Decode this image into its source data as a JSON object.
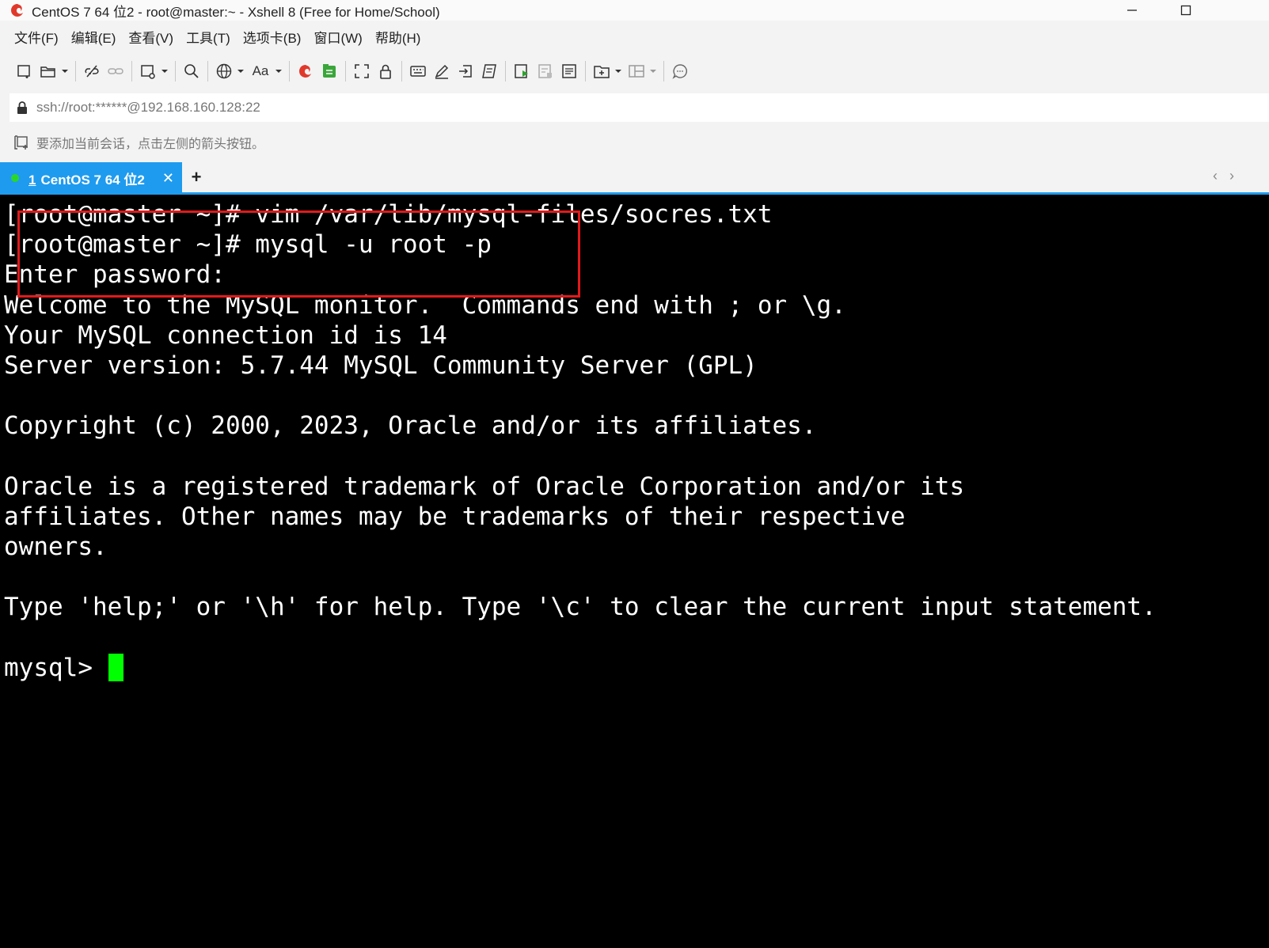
{
  "window": {
    "title": "CentOS 7 64 位2 - root@master:~ - Xshell 8 (Free for Home/School)"
  },
  "menu": [
    "文件(F)",
    "编辑(E)",
    "查看(V)",
    "工具(T)",
    "选项卡(B)",
    "窗口(W)",
    "帮助(H)"
  ],
  "toolbar": {
    "font_label": "Aa"
  },
  "address": {
    "value": "ssh://root:******@192.168.160.128:22"
  },
  "hint": {
    "text": "要添加当前会话，点击左侧的箭头按钮。"
  },
  "tabs": [
    {
      "number": "1",
      "label": "CentOS 7 64 位2",
      "active": true,
      "status": "connected"
    }
  ],
  "terminal": {
    "lines": [
      "[root@master ~]# vim /var/lib/mysql-files/socres.txt",
      "[root@master ~]# mysql -u root -p",
      "Enter password:",
      "Welcome to the MySQL monitor.  Commands end with ; or \\g.",
      "Your MySQL connection id is 14",
      "Server version: 5.7.44 MySQL Community Server (GPL)",
      "",
      "Copyright (c) 2000, 2023, Oracle and/or its affiliates.",
      "",
      "Oracle is a registered trademark of Oracle Corporation and/or its",
      "affiliates. Other names may be trademarks of their respective",
      "owners.",
      "",
      "Type 'help;' or '\\h' for help. Type '\\c' to clear the current input statement.",
      ""
    ],
    "prompt": "mysql> ",
    "cursor_color": "#00ff00",
    "highlight_color": "#e11a1a"
  },
  "colors": {
    "tab_accent": "#1e9bef",
    "status_green": "#2bd62b"
  }
}
